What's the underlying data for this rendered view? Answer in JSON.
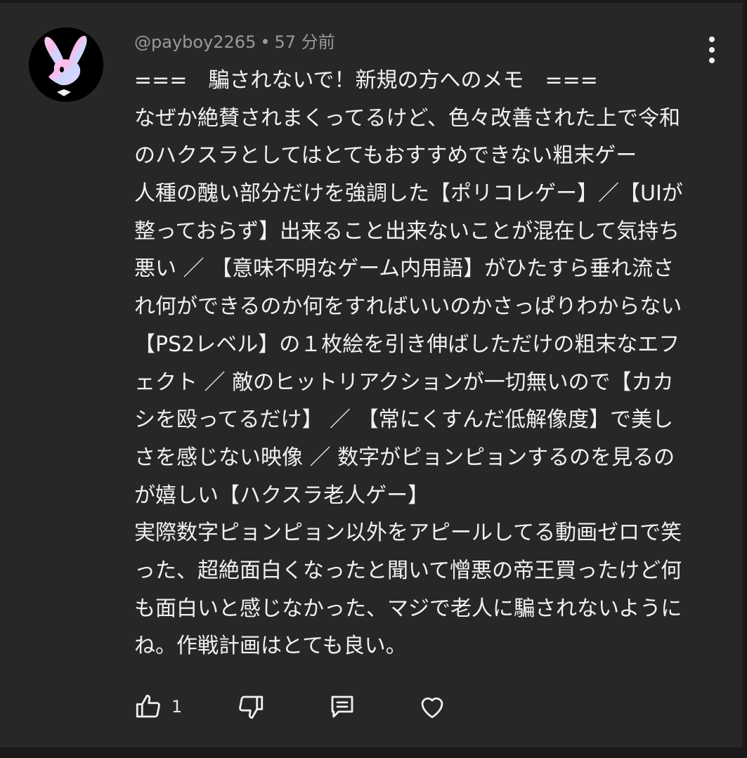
{
  "comment": {
    "author": "@payboy2265",
    "separator": "•",
    "time": "57 分前",
    "avatar_icon": "bunny-logo-icon",
    "lines": [
      "===　騙されないで！新規の方へのメモ　===",
      "なぜか絶賛されまくってるけど、色々改善された上で令和",
      "のハクスラとしてはとてもおすすめできない粗末ゲー",
      "人種の醜い部分だけを強調した【ポリコレゲー】／【UIが",
      "整っておらず】出来ること出来ないことが混在して気持ち",
      "悪い ／ 【意味不明なゲーム内用語】がひたすら垂れ流さ",
      "れ何ができるのか何をすればいいのかさっぱりわからない",
      "【PS2レベル】の１枚絵を引き伸ばしただけの粗末なエフ",
      "ェクト ／ 敵のヒットリアクションが一切無いので【カカ",
      "シを殴ってるだけ】 ／ 【常にくすんだ低解像度】で美し",
      "さを感じない映像 ／ 数字がピョンピョンするのを見るの",
      "が嬉しい【ハクスラ老人ゲー】",
      "実際数字ピョンピョン以外をアピールしてる動画ゼロで笑",
      "った、超絶面白くなったと聞いて憎悪の帝王買ったけど何",
      "も面白いと感じなかった、マジで老人に騙されないように",
      "ね。作戦計画はとても良い。"
    ]
  },
  "actions": {
    "like_count": "1",
    "like_icon": "thumbs-up-icon",
    "dislike_icon": "thumbs-down-icon",
    "reply_icon": "reply-comment-icon",
    "heart_icon": "heart-icon",
    "menu_icon": "more-vertical-icon"
  },
  "colors": {
    "background": "#272727",
    "text": "#f1f1f1",
    "meta_text": "#9a9a9a"
  }
}
